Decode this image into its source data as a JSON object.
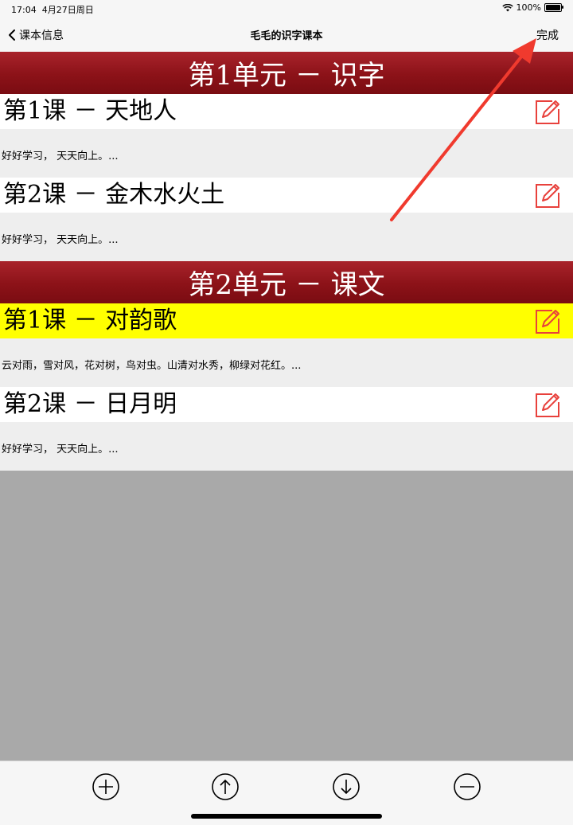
{
  "status_bar": {
    "time": "17:04",
    "date": "4月27日周日",
    "battery": "100%",
    "icons": [
      "wifi-icon",
      "battery-icon"
    ]
  },
  "nav": {
    "back_label": "课本信息",
    "title": "毛毛的识字课本",
    "done_label": "完成"
  },
  "units": [
    {
      "title": "第1单元 － 识字",
      "lessons": [
        {
          "title": "第1课 － 天地人",
          "desc": "好好学习，  天天向上。...",
          "selected": false
        },
        {
          "title": "第2课 － 金木水火土",
          "desc": "好好学习，  天天向上。...",
          "selected": false
        }
      ]
    },
    {
      "title": "第2单元 － 课文",
      "lessons": [
        {
          "title": "第1课 － 对韵歌",
          "desc": "云对雨，雪对风，花对树，鸟对虫。山清对水秀，柳绿对花红。...",
          "selected": true
        },
        {
          "title": "第2课 － 日月明",
          "desc": "好好学习，  天天向上。...",
          "selected": false
        }
      ]
    }
  ],
  "toolbar": {
    "buttons": [
      "add-icon",
      "move-up-icon",
      "move-down-icon",
      "remove-icon"
    ]
  },
  "colors": {
    "unit_header": "#8c1218",
    "selected_row": "#ffff00",
    "edit_icon": "#e8413c",
    "annotation_arrow": "#f03a2e"
  }
}
